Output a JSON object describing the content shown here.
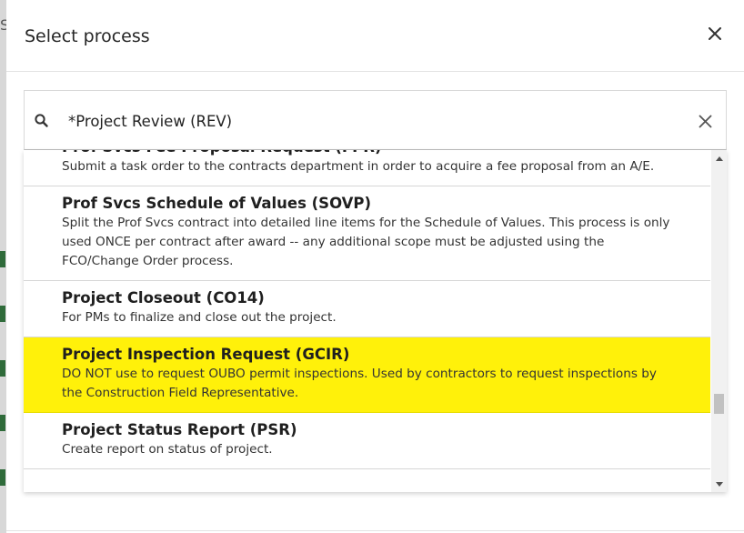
{
  "dialog": {
    "title": "Select process",
    "close_icon": "close-icon"
  },
  "search": {
    "value": "*Project Review (REV)",
    "search_icon": "search-icon",
    "clear_icon": "clear-icon"
  },
  "processes": [
    {
      "title": "Prof Svcs Fee Proposal Request (FPR)",
      "description": "Submit a task order to the contracts department in order to acquire a fee proposal from an A/E.",
      "highlighted": false
    },
    {
      "title": "Prof Svcs Schedule of Values (SOVP)",
      "description": "Split the Prof Svcs contract into detailed line items for the Schedule of Values. This process is only used ONCE per contract after award -- any additional scope must be adjusted using the FCO/Change Order process.",
      "highlighted": false
    },
    {
      "title": "Project Closeout (CO14)",
      "description": "For PMs to finalize and close out the project.",
      "highlighted": false
    },
    {
      "title": "Project Inspection Request (GCIR)",
      "description": "DO NOT use to request OUBO permit inspections. Used by contractors to request inspections by the Construction Field Representative.",
      "highlighted": true
    },
    {
      "title": "Project Status Report (PSR)",
      "description": "Create report on status of project.",
      "highlighted": false
    }
  ],
  "colors": {
    "highlight": "#fff10a",
    "background_accent": "#2f6b3a"
  }
}
